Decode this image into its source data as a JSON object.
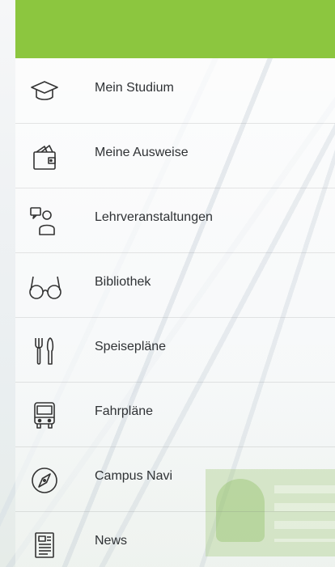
{
  "header": {
    "color": "#8cc63f"
  },
  "menu": {
    "items": [
      {
        "label": "Mein Studium",
        "icon": "graduation-cap-icon"
      },
      {
        "label": "Meine Ausweise",
        "icon": "wallet-icon"
      },
      {
        "label": "Lehrveranstaltungen",
        "icon": "lecturer-icon"
      },
      {
        "label": "Bibliothek",
        "icon": "glasses-icon"
      },
      {
        "label": "Speisepläne",
        "icon": "fork-knife-icon"
      },
      {
        "label": "Fahrpläne",
        "icon": "bus-icon"
      },
      {
        "label": "Campus Navi",
        "icon": "compass-icon"
      },
      {
        "label": "News",
        "icon": "newspaper-icon"
      }
    ]
  }
}
